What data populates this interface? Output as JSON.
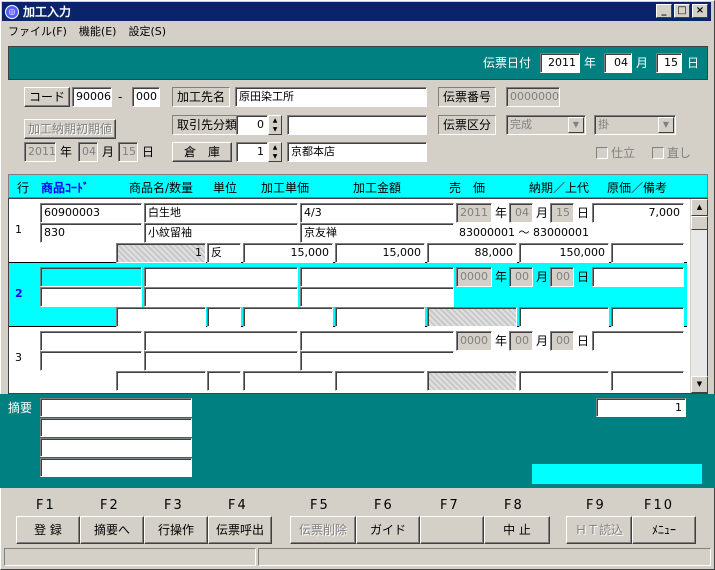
{
  "window": {
    "title": "加工入力",
    "icon": "app-icon"
  },
  "menu": [
    "ファイル(F)",
    "機能(E)",
    "設定(S)"
  ],
  "header": {
    "date_label": "伝票日付",
    "year": "2011",
    "year_unit": "年",
    "month": "04",
    "month_unit": "月",
    "day": "15",
    "day_unit": "日"
  },
  "form": {
    "code_label": "コード",
    "code": "90006",
    "dash": "-",
    "code_sub": "000",
    "processor_label": "加工先名",
    "processor_name": "原田染工所",
    "slip_no_label": "伝票番号",
    "slip_no": "00000009",
    "initial_period_button": "加工納期初期値",
    "trade_class_label": "取引先分類",
    "trade_class_value": "0",
    "trade_class_name": "",
    "slip_class_label": "伝票区分",
    "slip_class_value": "完成",
    "slip_type_value": "掛",
    "date_year": "2011",
    "date_year_unit": "年",
    "date_month": "04",
    "date_month_unit": "月",
    "date_day": "15",
    "date_day_unit": "日",
    "warehouse_label": "倉　庫",
    "warehouse_value": "1",
    "warehouse_name": "京都本店",
    "check_finish": "仕立",
    "check_fix": "直し"
  },
  "grid": {
    "headers": {
      "row": "行",
      "code": "商品ｺｰﾄﾞ",
      "name_qty": "商品名/数量",
      "unit": "単位",
      "unit_price": "加工単価",
      "amount": "加工金額",
      "sale_price": "売　価",
      "due_retail": "納期／上代",
      "cost_note": "原価／備考"
    },
    "rows": [
      {
        "num": "1",
        "code": "60900003",
        "name": "白生地",
        "spec": "4/3",
        "year": "2011",
        "month": "04",
        "day": "15",
        "cost": "7,000",
        "code2": "830",
        "name2": "小紋留袖",
        "spec2": "京友禅",
        "range": "83000001 ～ 83000001",
        "qty": "1",
        "unit": "反",
        "unit_price": "15,000",
        "amount": "15,000",
        "sale_price": "88,000",
        "retail": "150,000",
        "note": ""
      },
      {
        "num": "2",
        "code": "",
        "name": "",
        "spec": "",
        "year": "0000",
        "month": "00",
        "day": "00",
        "cost": "",
        "code2": "",
        "name2": "",
        "spec2": "",
        "range": "",
        "qty": "",
        "unit": "",
        "unit_price": "",
        "amount": "",
        "sale_price": "",
        "retail": "",
        "note": ""
      },
      {
        "num": "3",
        "code": "",
        "name": "",
        "spec": "",
        "year": "0000",
        "month": "00",
        "day": "00",
        "cost": "",
        "code2": "",
        "name2": "",
        "spec2": "",
        "range": "",
        "qty": "",
        "unit": "",
        "unit_price": "",
        "amount": "",
        "sale_price": "",
        "retail": "",
        "note": ""
      }
    ],
    "date_units": {
      "year": "年",
      "month": "月",
      "day": "日"
    }
  },
  "footer": {
    "summary_label": "摘要",
    "summary_count": "1"
  },
  "fkeys": {
    "labels": [
      "F1",
      "F2",
      "F3",
      "F4",
      "F5",
      "F6",
      "F7",
      "F8",
      "F9",
      "F10"
    ],
    "buttons": [
      "登 録",
      "摘要へ",
      "行操作",
      "伝票呼出",
      "伝票削除",
      "ガイド",
      "",
      "中 止",
      "ＨＴ読込",
      "ﾒﾆｭｰ"
    ]
  },
  "colors": {
    "teal": "#008080",
    "cyan": "#00ffff",
    "title_bar": "#0a246a",
    "face": "#d4d0c8"
  }
}
